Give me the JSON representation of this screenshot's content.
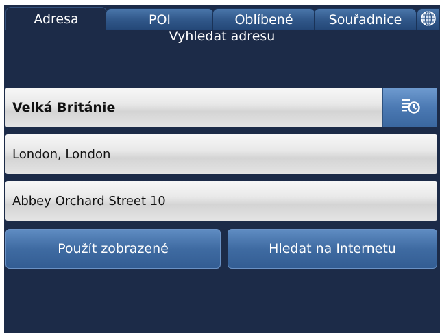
{
  "tabs": [
    {
      "label": "Adresa",
      "active": true
    },
    {
      "label": "POI",
      "active": false
    },
    {
      "label": "Oblíbené",
      "active": false
    },
    {
      "label": "Souřadnice",
      "active": false
    }
  ],
  "tab_icon": "globe-icon",
  "heading": "Vyhledat adresu",
  "fields": {
    "country": "Velká Británie",
    "city": "London, London",
    "street": "Abbey Orchard Street 10"
  },
  "history_icon": "history-list-icon",
  "actions": {
    "use_displayed": "Použít zobrazené",
    "search_internet": "Hledat na Internetu"
  },
  "colors": {
    "background": "#1c2b48",
    "tab": "#2f5688",
    "button": "#3f6ba2",
    "field": "#e4e4e4"
  }
}
